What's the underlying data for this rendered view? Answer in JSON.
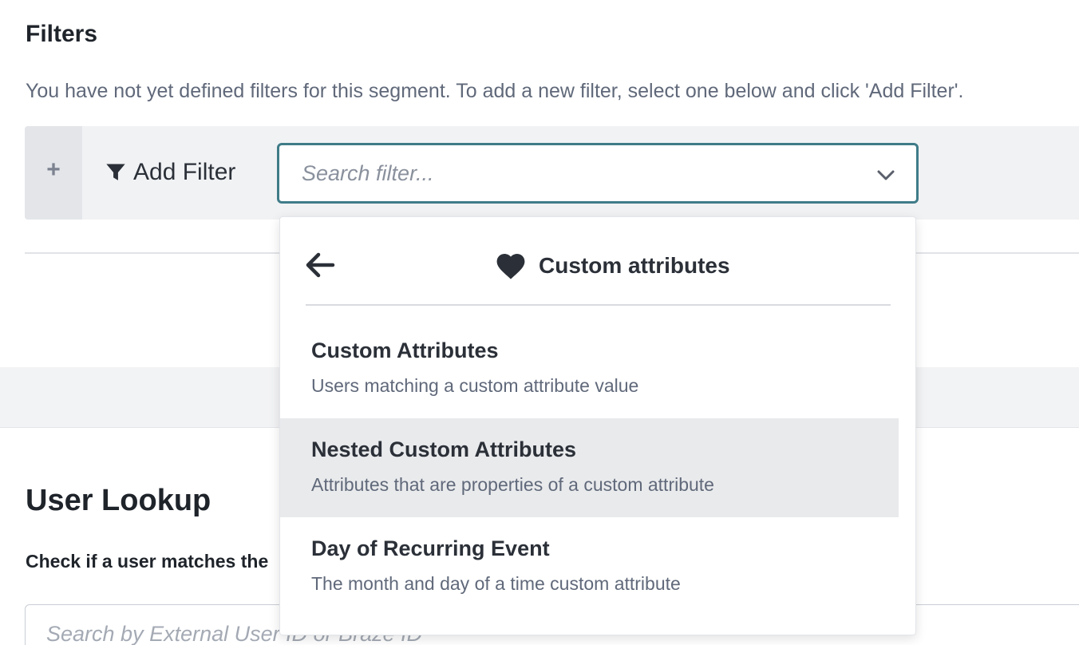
{
  "filters": {
    "title": "Filters",
    "description": "You have not yet defined filters for this segment. To add a new filter, select one below and click 'Add Filter'.",
    "add_button_symbol": "+",
    "add_filter_label": "Add Filter",
    "add_filter_icon": "funnel-icon",
    "search_placeholder": "Search filter...",
    "search_value": ""
  },
  "dropdown": {
    "back_icon": "arrow-left-icon",
    "category_icon": "heart-icon",
    "category_title": "Custom attributes",
    "items": [
      {
        "title": "Custom Attributes",
        "description": "Users matching a custom attribute value",
        "highlighted": false
      },
      {
        "title": "Nested Custom Attributes",
        "description": "Attributes that are properties of a custom attribute",
        "highlighted": true
      },
      {
        "title": "Day of Recurring Event",
        "description": "The month and day of a time custom attribute",
        "highlighted": false
      }
    ]
  },
  "user_lookup": {
    "title": "User Lookup",
    "description": "Check if a user matches the",
    "search_placeholder": "Search by External User ID or Braze ID"
  },
  "colors": {
    "focus_border": "#3f7c88",
    "highlight_row": "#e9eaec",
    "text_primary": "#2b3038",
    "text_secondary": "#60697a"
  }
}
